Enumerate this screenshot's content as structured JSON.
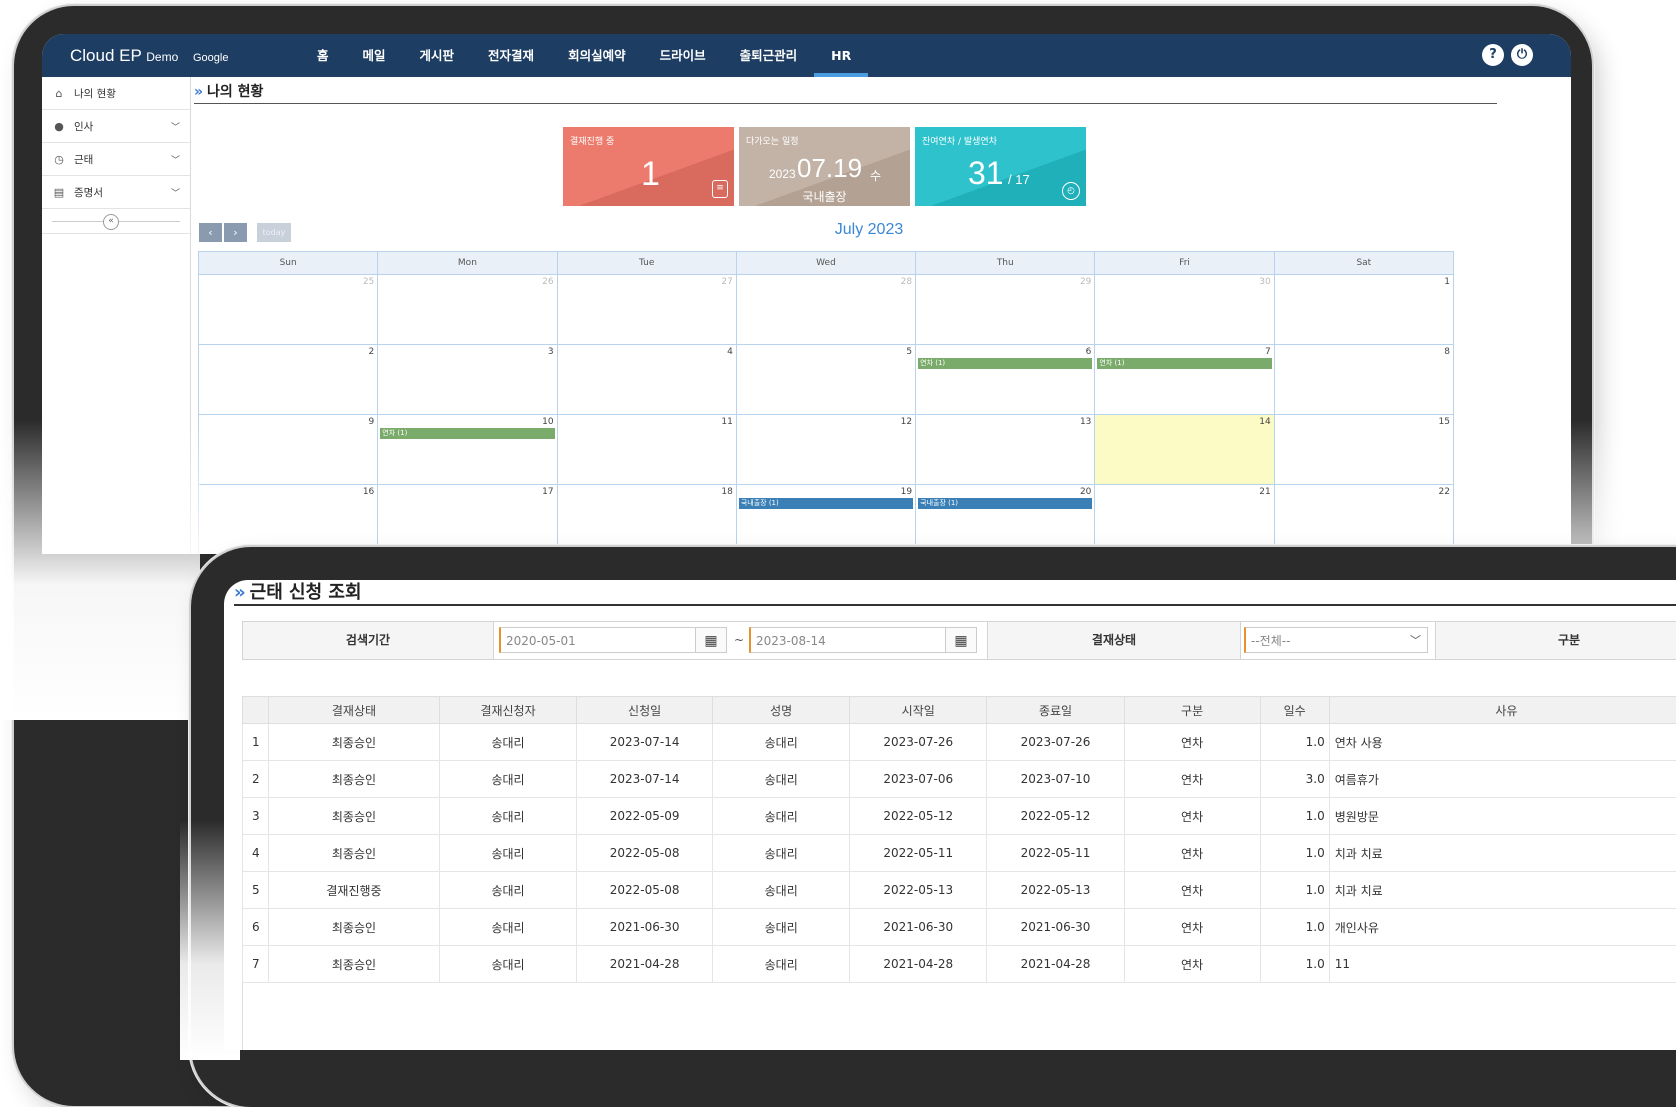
{
  "app": {
    "brand": "Cloud EP",
    "brand_suffix": "Demo",
    "brand_sub": "Google"
  },
  "topnav": {
    "items": [
      "홈",
      "메일",
      "게시판",
      "전자결재",
      "회의실예약",
      "드라이브",
      "출퇴근관리",
      "HR"
    ],
    "active": "HR",
    "help_icon": "?",
    "power_icon": "⏻"
  },
  "sidebar": {
    "items": [
      {
        "label": "나의 현황",
        "icon": "home-icon"
      },
      {
        "label": "인사",
        "icon": "user-icon"
      },
      {
        "label": "근태",
        "icon": "clock-icon"
      },
      {
        "label": "증명서",
        "icon": "document-icon"
      }
    ]
  },
  "dashboard": {
    "title": "나의 현황",
    "cards": {
      "pending": {
        "label": "결재진행 중",
        "value": "1"
      },
      "upcoming": {
        "label": "다가오는 일정",
        "year": "2023",
        "date": "07.19",
        "weekday": "수",
        "event": "국내출장"
      },
      "leave": {
        "label": "잔여연차 / 발생연차",
        "remaining": "31",
        "total": "/ 17"
      }
    }
  },
  "calendar": {
    "title": "July 2023",
    "prev": "‹",
    "next": "›",
    "today": "today",
    "weekdays": [
      "Sun",
      "Mon",
      "Tue",
      "Wed",
      "Thu",
      "Fri",
      "Sat"
    ],
    "weeks": [
      [
        "25",
        "26",
        "27",
        "28",
        "29",
        "30",
        "1"
      ],
      [
        "2",
        "3",
        "4",
        "5",
        "6",
        "7",
        "8"
      ],
      [
        "9",
        "10",
        "11",
        "12",
        "13",
        "14",
        "15"
      ],
      [
        "16",
        "17",
        "18",
        "19",
        "20",
        "21",
        "22"
      ]
    ],
    "events": {
      "thu6": "연차 (1)",
      "fri7": "연차 (1)",
      "mon10": "연차 (1)",
      "wed19": "국내출장 (1)",
      "thu20": "국내출장 (1)"
    },
    "colors": {
      "leave": "#7aab6a",
      "trip": "#3a7fb5",
      "today": "#fcfbc6"
    }
  },
  "attendance": {
    "title": "근태 신청 조회",
    "search": {
      "period_label": "검색기간",
      "from": "2020-05-01",
      "to": "2023-08-14",
      "status_label": "결재상태",
      "status_value": "--전체--",
      "type_label": "구분"
    },
    "columns": [
      "결재상태",
      "결재신청자",
      "신청일",
      "성명",
      "시작일",
      "종료일",
      "구분",
      "일수",
      "사유"
    ],
    "rows": [
      [
        "1",
        "최종승인",
        "송대리",
        "2023-07-14",
        "송대리",
        "2023-07-26",
        "2023-07-26",
        "연차",
        "1.0",
        "연차 사용"
      ],
      [
        "2",
        "최종승인",
        "송대리",
        "2023-07-14",
        "송대리",
        "2023-07-06",
        "2023-07-10",
        "연차",
        "3.0",
        "여름휴가"
      ],
      [
        "3",
        "최종승인",
        "송대리",
        "2022-05-09",
        "송대리",
        "2022-05-12",
        "2022-05-12",
        "연차",
        "1.0",
        "병원방문"
      ],
      [
        "4",
        "최종승인",
        "송대리",
        "2022-05-08",
        "송대리",
        "2022-05-11",
        "2022-05-11",
        "연차",
        "1.0",
        "치과 치료"
      ],
      [
        "5",
        "결재진행중",
        "송대리",
        "2022-05-08",
        "송대리",
        "2022-05-13",
        "2022-05-13",
        "연차",
        "1.0",
        "치과 치료"
      ],
      [
        "6",
        "최종승인",
        "송대리",
        "2021-06-30",
        "송대리",
        "2021-06-30",
        "2021-06-30",
        "연차",
        "1.0",
        "개인사유"
      ],
      [
        "7",
        "최종승인",
        "송대리",
        "2021-04-28",
        "송대리",
        "2021-04-28",
        "2021-04-28",
        "연차",
        "1.0",
        "11"
      ]
    ]
  }
}
